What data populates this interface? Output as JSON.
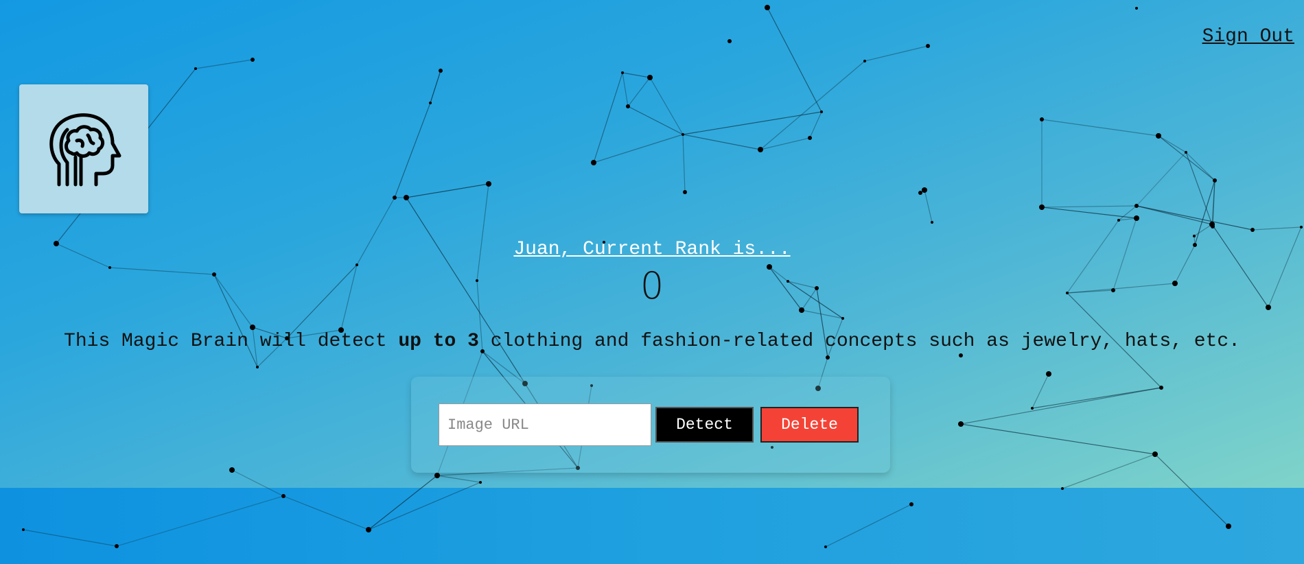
{
  "header": {
    "signout_label": "Sign Out"
  },
  "logo": {
    "icon": "brain-head-icon"
  },
  "rank": {
    "title": "Juan, Current Rank is...",
    "value": "0"
  },
  "description": {
    "before": "This Magic Brain will detect ",
    "bold": "up to 3",
    "after": " clothing and fashion-related concepts such as jewelry, hats, etc."
  },
  "form": {
    "input_placeholder": "Image URL",
    "input_value": "",
    "detect_label": "Detect",
    "delete_label": "Delete"
  },
  "colors": {
    "bg_start": "#1399e2",
    "bg_end": "#7fd3c9",
    "delete_button": "#f44336",
    "detect_button": "#000000"
  }
}
